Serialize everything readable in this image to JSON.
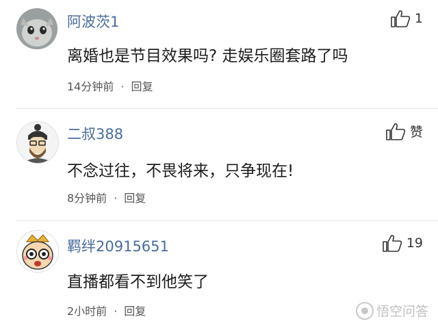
{
  "comments": [
    {
      "username": "阿波茨1",
      "text": "离婚也是节目效果吗? 走娱乐圈套路了吗",
      "time": "14分钟前",
      "separator": "·",
      "reply_label": "回复",
      "likes": "1"
    },
    {
      "username": "二叔388",
      "text": "不念过往，不畏将来，只争现在!",
      "time": "8分钟前",
      "separator": "·",
      "reply_label": "回复",
      "likes": "赞"
    },
    {
      "username": "羁绊20915651",
      "text": "直播都看不到他笑了",
      "time": "2小时前",
      "separator": "·",
      "reply_label": "回复",
      "likes": "19"
    }
  ],
  "watermark": {
    "text": "悟空问答",
    "logo_icon": "wukong-logo-icon"
  },
  "colors": {
    "username": "#4a6d9a",
    "content": "#1c1c1c",
    "meta": "#555555",
    "divider": "#e6e6e6"
  }
}
